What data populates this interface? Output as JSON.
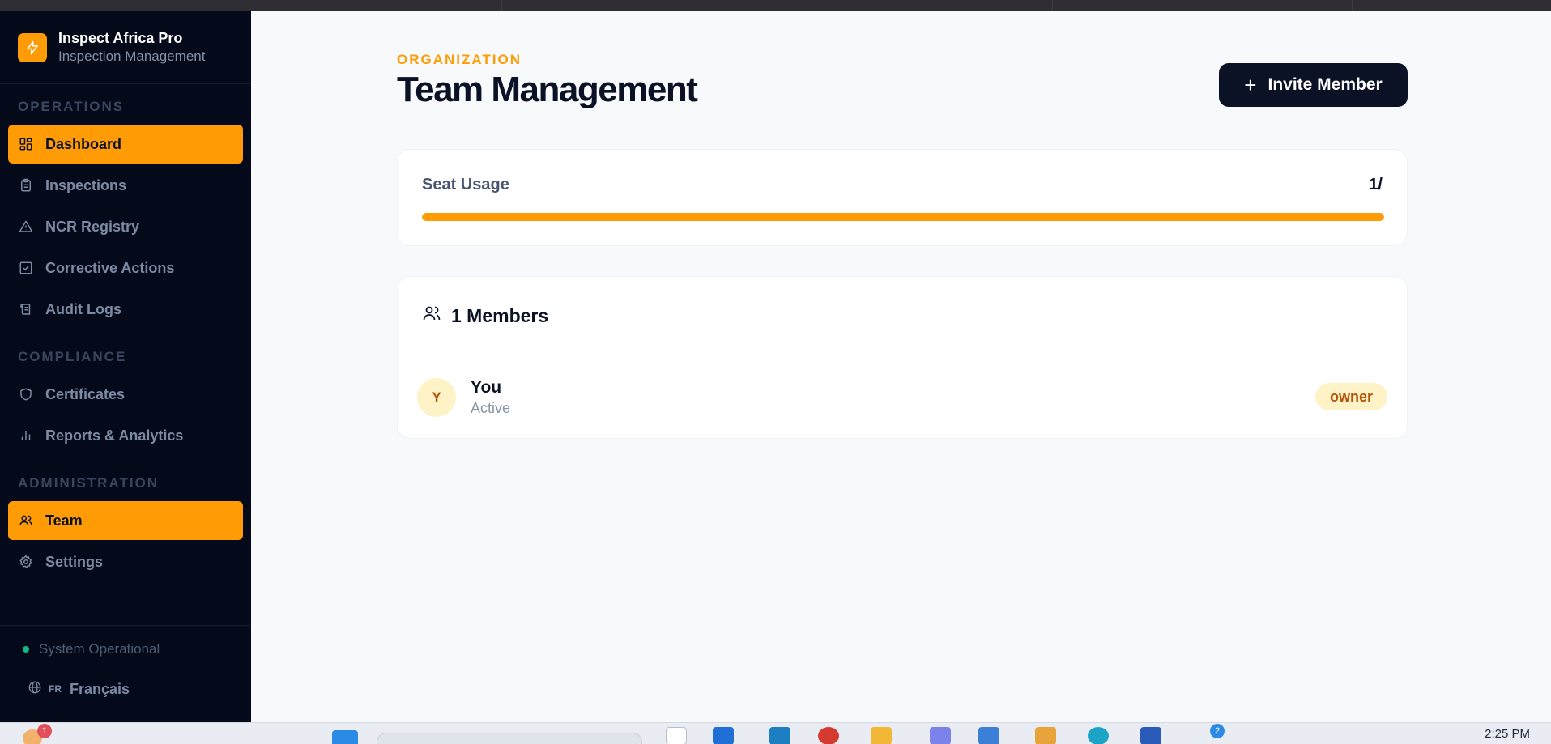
{
  "app": {
    "name": "Inspect Africa Pro",
    "tagline": "Inspection Management"
  },
  "sidebar": {
    "sections": [
      {
        "label": "OPERATIONS",
        "items": [
          {
            "label": "Dashboard",
            "icon": "dashboard-grid-icon",
            "active": true
          },
          {
            "label": "Inspections",
            "icon": "clipboard-icon",
            "active": false
          },
          {
            "label": "NCR Registry",
            "icon": "warning-triangle-icon",
            "active": false
          },
          {
            "label": "Corrective Actions",
            "icon": "check-square-icon",
            "active": false
          },
          {
            "label": "Audit Logs",
            "icon": "scroll-icon",
            "active": false
          }
        ]
      },
      {
        "label": "COMPLIANCE",
        "items": [
          {
            "label": "Certificates",
            "icon": "shield-icon",
            "active": false
          },
          {
            "label": "Reports & Analytics",
            "icon": "bar-chart-icon",
            "active": false
          }
        ]
      },
      {
        "label": "ADMINISTRATION",
        "items": [
          {
            "label": "Team",
            "icon": "users-icon",
            "active": true
          },
          {
            "label": "Settings",
            "icon": "gear-icon",
            "active": false
          }
        ]
      }
    ],
    "footer": {
      "status": "System Operational",
      "lang_code": "FR",
      "lang_label": "Français"
    }
  },
  "main": {
    "eyebrow": "ORGANIZATION",
    "title": "Team Management",
    "invite_label": "Invite Member",
    "seat_usage": {
      "label": "Seat Usage",
      "value": "1/",
      "fill_fraction": 1.0
    },
    "members": {
      "heading": "1 Members",
      "list": [
        {
          "initial": "Y",
          "name": "You",
          "status": "Active",
          "role": "owner"
        }
      ]
    }
  },
  "taskbar": {
    "clock": "2:25 PM",
    "badge_left": "1",
    "badge_right": "2"
  },
  "colors": {
    "accent": "#ff9b05",
    "sidebar_bg": "#040a1a",
    "primary_dark": "#0b1226",
    "status_green": "#10b981"
  }
}
